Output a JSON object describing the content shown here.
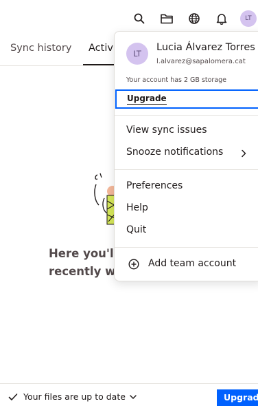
{
  "toolbar": {
    "icons": [
      "search-icon",
      "folder-icon",
      "globe-icon",
      "bell-icon"
    ],
    "avatar_initials": "LT"
  },
  "tabs": [
    {
      "label": "Sync history",
      "active": false
    },
    {
      "label": "Activity",
      "active": true
    }
  ],
  "empty_state": {
    "text": "Here you'll find files you've recently worked with."
  },
  "footer": {
    "status": "Your files are up to date",
    "upgrade_label": "Upgrade"
  },
  "account_menu": {
    "avatar_initials": "LT",
    "name": "Lucia Álvarez Torres",
    "email": "l.alvarez@sapalomera.cat",
    "storage_note": "Your account has 2 GB storage",
    "upgrade_label": "Upgrade",
    "items": [
      {
        "label": "View sync issues"
      },
      {
        "label": "Snooze notifications",
        "has_submenu": true
      },
      {
        "label": "Preferences"
      },
      {
        "label": "Help"
      },
      {
        "label": "Quit"
      }
    ],
    "add_team_label": "Add team account"
  },
  "colors": {
    "accent": "#0061fe",
    "avatar_bg": "#d4c3ef",
    "text": "#1e1919"
  }
}
